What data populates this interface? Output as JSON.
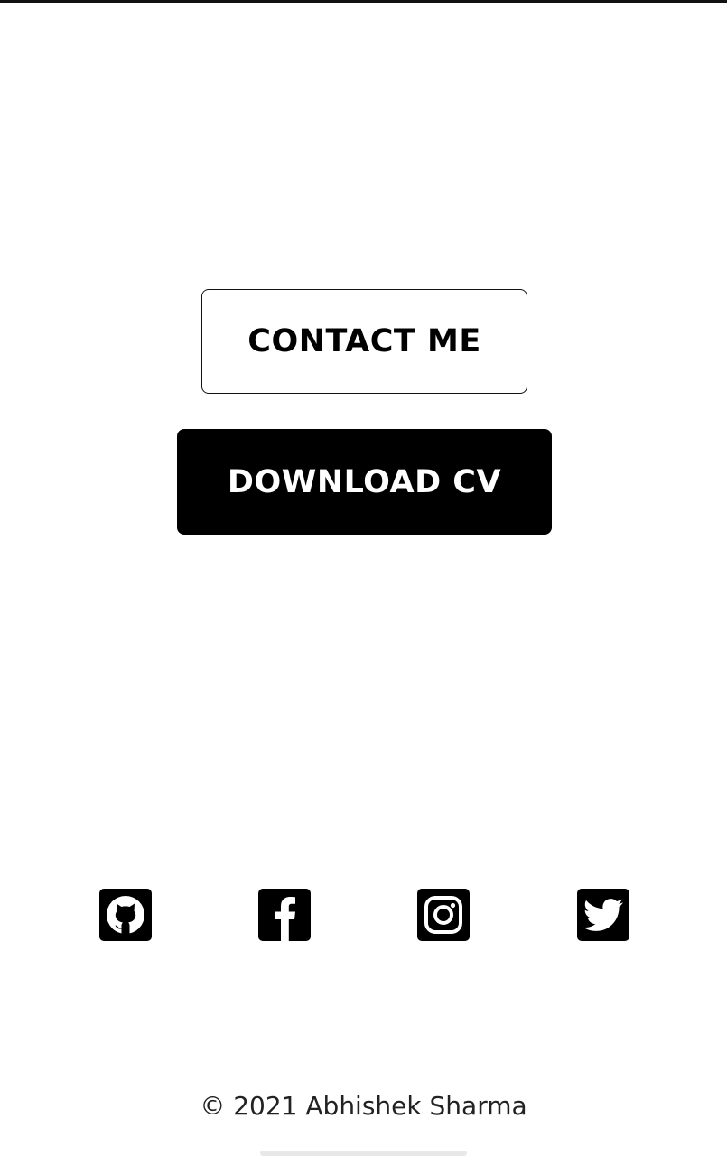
{
  "buttons": {
    "contact_label": "CONTACT ME",
    "download_label": "DOWNLOAD CV"
  },
  "social": {
    "icons": [
      "github-icon",
      "facebook-icon",
      "instagram-icon",
      "twitter-icon"
    ]
  },
  "footer": {
    "copyright": "© 2021 Abhishek Sharma"
  },
  "colors": {
    "primary": "#000000",
    "background": "#ffffff",
    "text": "#222222"
  }
}
